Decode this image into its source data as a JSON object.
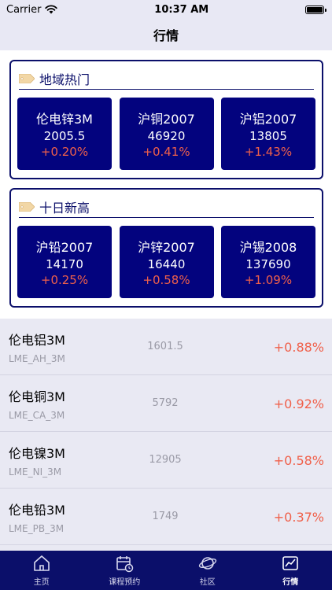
{
  "status_bar": {
    "carrier": "Carrier",
    "time": "10:37 AM"
  },
  "nav": {
    "title": "行情"
  },
  "hot_region": {
    "title": "地域热门",
    "cards": [
      {
        "name": "伦电锌3M",
        "price": "2005.5",
        "change": "+0.20%"
      },
      {
        "name": "沪铜2007",
        "price": "46920",
        "change": "+0.41%"
      },
      {
        "name": "沪铝2007",
        "price": "13805",
        "change": "+1.43%"
      }
    ]
  },
  "ten_day_high": {
    "title": "十日新高",
    "cards": [
      {
        "name": "沪铅2007",
        "price": "14170",
        "change": "+0.25%"
      },
      {
        "name": "沪锌2007",
        "price": "16440",
        "change": "+0.58%"
      },
      {
        "name": "沪锡2008",
        "price": "137690",
        "change": "+1.09%"
      }
    ]
  },
  "list": [
    {
      "name": "伦电铝3M",
      "code": "LME_AH_3M",
      "price": "1601.5",
      "change": "+0.88%"
    },
    {
      "name": "伦电铜3M",
      "code": "LME_CA_3M",
      "price": "5792",
      "change": "+0.92%"
    },
    {
      "name": "伦电镍3M",
      "code": "LME_NI_3M",
      "price": "12905",
      "change": "+0.58%"
    },
    {
      "name": "伦电铅3M",
      "code": "LME_PB_3M",
      "price": "1749",
      "change": "+0.37%"
    }
  ],
  "tabs": [
    {
      "label": "主页",
      "icon": "home-icon"
    },
    {
      "label": "课程预约",
      "icon": "calendar-icon"
    },
    {
      "label": "社区",
      "icon": "planet-icon"
    },
    {
      "label": "行情",
      "icon": "chart-icon"
    }
  ],
  "colors": {
    "primary": "#0b0f6a",
    "card": "#03037e",
    "up": "#f0604a",
    "list_bg": "#e9e9f3"
  }
}
